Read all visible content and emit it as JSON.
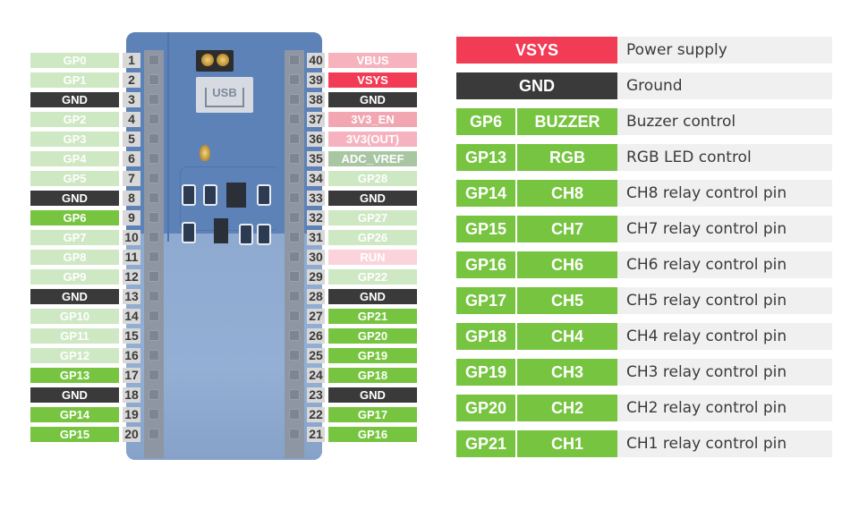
{
  "board": {
    "usb_label": "USB"
  },
  "colors": {
    "gpio_unused": "#cde8c2",
    "gpio_used": "#76c43f",
    "ground": "#3a3a3a",
    "vsys": "#f23c55",
    "vbus": "#f6b3bd",
    "adc_vref": "#a9c6a3",
    "run": "#fad4da",
    "pin_number_bg": "#d8d8d8",
    "description_bg": "#f0f0f0"
  },
  "left_pins": [
    {
      "num": "1",
      "label": "GP0",
      "type": "gpio-light"
    },
    {
      "num": "2",
      "label": "GP1",
      "type": "gpio-light"
    },
    {
      "num": "3",
      "label": "GND",
      "type": "gnd"
    },
    {
      "num": "4",
      "label": "GP2",
      "type": "gpio-light"
    },
    {
      "num": "5",
      "label": "GP3",
      "type": "gpio-light"
    },
    {
      "num": "6",
      "label": "GP4",
      "type": "gpio-light"
    },
    {
      "num": "7",
      "label": "GP5",
      "type": "gpio-light"
    },
    {
      "num": "8",
      "label": "GND",
      "type": "gnd"
    },
    {
      "num": "9",
      "label": "GP6",
      "type": "gpio-used"
    },
    {
      "num": "10",
      "label": "GP7",
      "type": "gpio-light"
    },
    {
      "num": "11",
      "label": "GP8",
      "type": "gpio-light"
    },
    {
      "num": "12",
      "label": "GP9",
      "type": "gpio-light"
    },
    {
      "num": "13",
      "label": "GND",
      "type": "gnd"
    },
    {
      "num": "14",
      "label": "GP10",
      "type": "gpio-light"
    },
    {
      "num": "15",
      "label": "GP11",
      "type": "gpio-light"
    },
    {
      "num": "16",
      "label": "GP12",
      "type": "gpio-light"
    },
    {
      "num": "17",
      "label": "GP13",
      "type": "gpio-used"
    },
    {
      "num": "18",
      "label": "GND",
      "type": "gnd"
    },
    {
      "num": "19",
      "label": "GP14",
      "type": "gpio-used"
    },
    {
      "num": "20",
      "label": "GP15",
      "type": "gpio-used"
    }
  ],
  "right_pins": [
    {
      "num": "40",
      "label": "VBUS",
      "type": "vbus"
    },
    {
      "num": "39",
      "label": "VSYS",
      "type": "vsys"
    },
    {
      "num": "38",
      "label": "GND",
      "type": "gnd"
    },
    {
      "num": "37",
      "label": "3V3_EN",
      "type": "3v3en"
    },
    {
      "num": "36",
      "label": "3V3(OUT)",
      "type": "3v3out"
    },
    {
      "num": "35",
      "label": "ADC_VREF",
      "type": "adc"
    },
    {
      "num": "34",
      "label": "GP28",
      "type": "gpio-light"
    },
    {
      "num": "33",
      "label": "GND",
      "type": "gnd"
    },
    {
      "num": "32",
      "label": "GP27",
      "type": "gpio-light"
    },
    {
      "num": "31",
      "label": "GP26",
      "type": "gpio-light"
    },
    {
      "num": "30",
      "label": "RUN",
      "type": "run"
    },
    {
      "num": "29",
      "label": "GP22",
      "type": "gpio-light"
    },
    {
      "num": "28",
      "label": "GND",
      "type": "gnd"
    },
    {
      "num": "27",
      "label": "GP21",
      "type": "gpio-used"
    },
    {
      "num": "26",
      "label": "GP20",
      "type": "gpio-used"
    },
    {
      "num": "25",
      "label": "GP19",
      "type": "gpio-used"
    },
    {
      "num": "24",
      "label": "GP18",
      "type": "gpio-used"
    },
    {
      "num": "23",
      "label": "GND",
      "type": "gnd"
    },
    {
      "num": "22",
      "label": "GP17",
      "type": "gpio-used"
    },
    {
      "num": "21",
      "label": "GP16",
      "type": "gpio-used"
    }
  ],
  "legend": [
    {
      "pin": "VSYS",
      "function": "",
      "description": "Power supply",
      "kind": "vsys"
    },
    {
      "pin": "GND",
      "function": "",
      "description": "Ground",
      "kind": "gnd"
    },
    {
      "pin": "GP6",
      "function": "BUZZER",
      "description": "Buzzer control",
      "kind": "gpio"
    },
    {
      "pin": "GP13",
      "function": "RGB",
      "description": "RGB LED control",
      "kind": "gpio"
    },
    {
      "pin": "GP14",
      "function": "CH8",
      "description": "CH8 relay control pin",
      "kind": "gpio"
    },
    {
      "pin": "GP15",
      "function": "CH7",
      "description": "CH7 relay control pin",
      "kind": "gpio"
    },
    {
      "pin": "GP16",
      "function": "CH6",
      "description": "CH6 relay control pin",
      "kind": "gpio"
    },
    {
      "pin": "GP17",
      "function": "CH5",
      "description": "CH5 relay control pin",
      "kind": "gpio"
    },
    {
      "pin": "GP18",
      "function": "CH4",
      "description": "CH4 relay control pin",
      "kind": "gpio"
    },
    {
      "pin": "GP19",
      "function": "CH3",
      "description": "CH3 relay control pin",
      "kind": "gpio"
    },
    {
      "pin": "GP20",
      "function": "CH2",
      "description": "CH2 relay control pin",
      "kind": "gpio"
    },
    {
      "pin": "GP21",
      "function": "CH1",
      "description": "CH1 relay control pin",
      "kind": "gpio"
    }
  ]
}
